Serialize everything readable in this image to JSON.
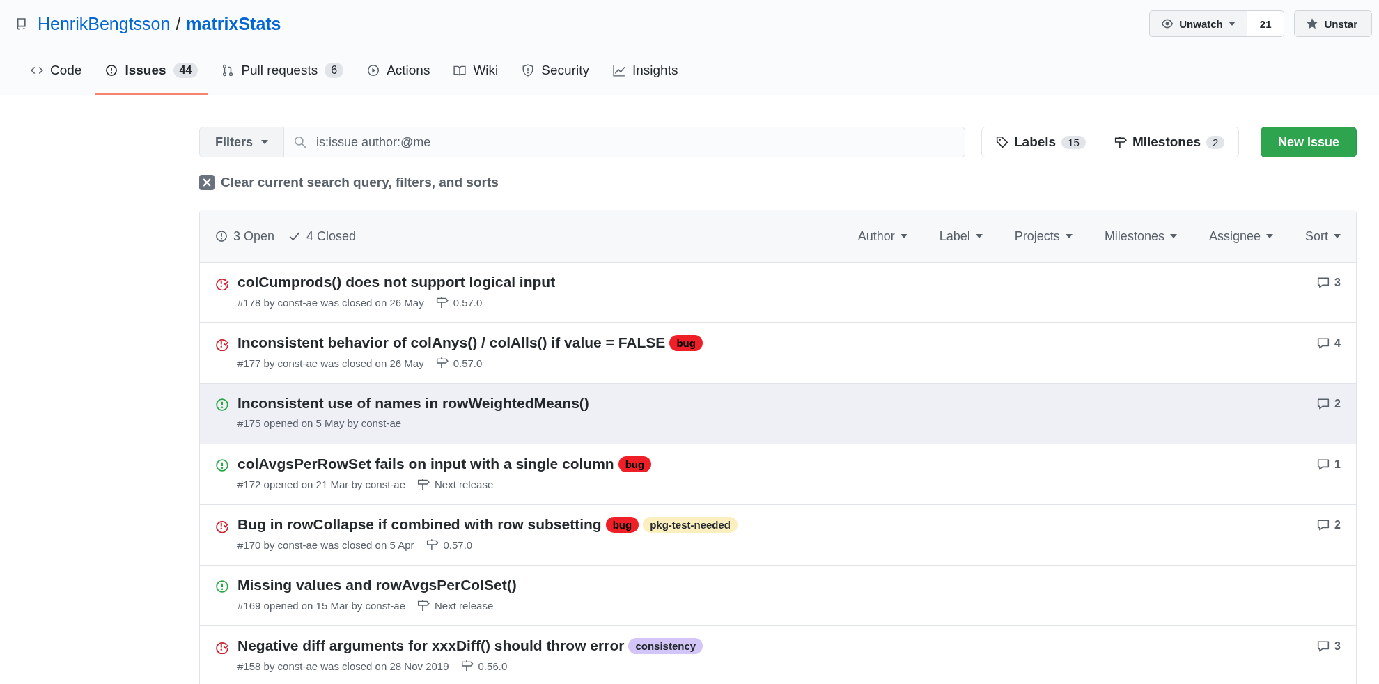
{
  "repo": {
    "owner": "HenrikBengtsson",
    "separator": "/",
    "name": "matrixStats"
  },
  "repo_actions": [
    {
      "kind": "watch",
      "label": "Unwatch",
      "count": "21"
    },
    {
      "kind": "star",
      "label": "Unstar"
    }
  ],
  "tabs": [
    {
      "kind": "code",
      "label": "Code",
      "selected": false
    },
    {
      "kind": "issues",
      "label": "Issues",
      "count": "44",
      "selected": true
    },
    {
      "kind": "pulls",
      "label": "Pull requests",
      "count": "6",
      "selected": false
    },
    {
      "kind": "actions",
      "label": "Actions",
      "selected": false
    },
    {
      "kind": "wiki",
      "label": "Wiki",
      "selected": false
    },
    {
      "kind": "security",
      "label": "Security",
      "selected": false
    },
    {
      "kind": "insights",
      "label": "Insights",
      "selected": false
    }
  ],
  "filters": {
    "button": "Filters",
    "search_value": "is:issue author:@me"
  },
  "labels_button": {
    "label": "Labels",
    "count": "15"
  },
  "milestones_button": {
    "label": "Milestones",
    "count": "2"
  },
  "new_issue_button": "New issue",
  "clear_query": "Clear current search query, filters, and sorts",
  "list_header": {
    "states": [
      {
        "kind": "open",
        "label": "3 Open"
      },
      {
        "kind": "closed",
        "label": "4 Closed"
      }
    ],
    "menus": [
      "Author",
      "Label",
      "Projects",
      "Milestones",
      "Assignee",
      "Sort"
    ]
  },
  "issues": [
    {
      "kind": "closed",
      "title": "colCumprods() does not support logical input",
      "meta": "#178 by const-ae was closed on 26 May",
      "milestone": "0.57.0",
      "comments": "3",
      "hovered": false
    },
    {
      "kind": "closed",
      "title": "Inconsistent behavior of colAnys() / colAlls() if value = FALSE",
      "labels": [
        {
          "name": "bug",
          "color": "#ee1f27"
        }
      ],
      "meta": "#177 by const-ae was closed on 26 May",
      "milestone": "0.57.0",
      "comments": "4",
      "hovered": false
    },
    {
      "kind": "open",
      "title": "Inconsistent use of names in rowWeightedMeans()",
      "meta": "#175 opened on 5 May by const-ae",
      "comments": "2",
      "hovered": true
    },
    {
      "kind": "open",
      "title": "colAvgsPerRowSet fails on input with a single column",
      "labels": [
        {
          "name": "bug",
          "color": "#ee1f27"
        }
      ],
      "meta": "#172 opened on 21 Mar by const-ae",
      "milestone": "Next release",
      "comments": "1",
      "hovered": false
    },
    {
      "kind": "closed",
      "title": "Bug in rowCollapse if combined with row subsetting",
      "labels": [
        {
          "name": "bug",
          "color": "#ee1f27"
        },
        {
          "name": "pkg-test-needed",
          "color": "#fbeebf"
        }
      ],
      "meta": "#170 by const-ae was closed on 5 Apr",
      "milestone": "0.57.0",
      "comments": "2",
      "hovered": false
    },
    {
      "kind": "open",
      "title": "Missing values and rowAvgsPerColSet()",
      "meta": "#169 opened on 15 Mar by const-ae",
      "milestone": "Next release",
      "hovered": false
    },
    {
      "kind": "closed",
      "title": "Negative diff arguments for xxxDiff() should throw error",
      "labels": [
        {
          "name": "consistency",
          "color": "#d4c5f9"
        }
      ],
      "meta": "#158 by const-ae was closed on 28 Nov 2019",
      "milestone": "0.56.0",
      "comments": "3",
      "hovered": false
    }
  ]
}
